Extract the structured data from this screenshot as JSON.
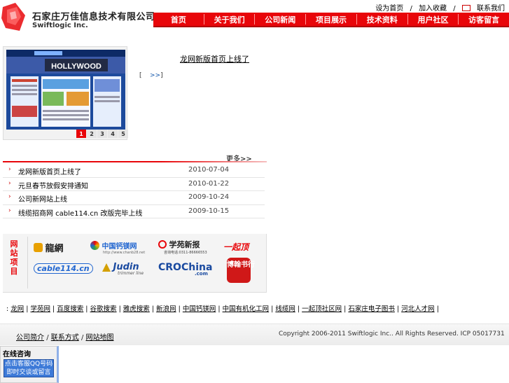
{
  "header": {
    "company_cn": "石家庄万佳信息技术有限公司",
    "company_en": "Swiftlogic Inc.",
    "top_links": [
      "设为首页",
      "/",
      "加入收藏",
      "/",
      "联系我们"
    ]
  },
  "nav": {
    "items": [
      "首页",
      "关于我们",
      "公司新闻",
      "项目展示",
      "技术资料",
      "用户社区",
      "访客留言"
    ]
  },
  "feature": {
    "title": "龙网新版首页上线了",
    "more_prefix": "[",
    "more_link": ">>",
    "more_suffix": "]",
    "pages": [
      "1",
      "2",
      "3",
      "4",
      "5"
    ],
    "screenshot_banner": "HOLLYWOOD"
  },
  "news": {
    "more_label": "更多>>",
    "items": [
      {
        "title": "龙网新版首页上线了",
        "date": "2010-07-04"
      },
      {
        "title": "元旦春节放假安排通知",
        "date": "2010-01-22"
      },
      {
        "title": "公司新网站上线",
        "date": "2009-10-24"
      },
      {
        "title": "线缆招商网 cable114.cn 改版完毕上线",
        "date": "2009-10-15"
      }
    ]
  },
  "projects": {
    "title": "网站项目",
    "logos": [
      {
        "name": "龍網"
      },
      {
        "name": "中国钙镁网",
        "sub": "http://www.chanb28.net"
      },
      {
        "name": "学苑新报",
        "sub": "咨询电话:0311-86666553"
      },
      {
        "name": "一起顶"
      },
      {
        "name": "cable114.cn"
      },
      {
        "name": "Judin",
        "sub": "trimmer line"
      },
      {
        "name": "CROChina",
        "sub": ".com"
      },
      {
        "name": "博翰书行"
      }
    ]
  },
  "links": {
    "lead": ":",
    "items": [
      "龙网",
      "学苑网",
      "百度搜索",
      "谷歌搜索",
      "雅虎搜索",
      "新浪网",
      "中国钙镁网",
      "中国有机化工网",
      "线缆网",
      "一起顶社区网",
      "石家庄电子图书",
      "河北人才网"
    ]
  },
  "footer": {
    "links": [
      "公司简介",
      "/",
      "联系方式",
      "/",
      "网站地图"
    ],
    "copyright": "Copyright 2006-2011 Swiftlogic Inc.. All Rights Reserved.    ICP  05017731"
  },
  "consult": {
    "title": "在线咨询",
    "button_line1": "点击客服QQ号码",
    "button_line2": "即时交谈或留言"
  },
  "colors": {
    "brand_red": "#e8060a",
    "link_blue": "#1155aa"
  }
}
